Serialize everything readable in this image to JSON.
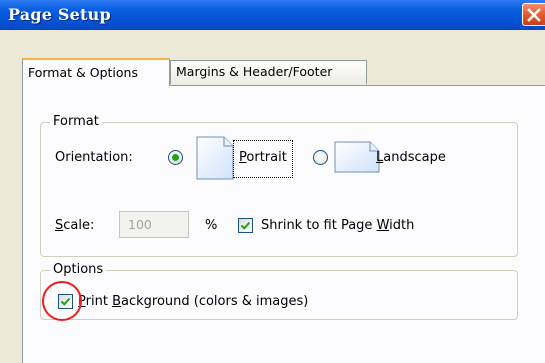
{
  "window": {
    "title": "Page Setup"
  },
  "tabs": [
    {
      "label": "Format & Options",
      "active": true
    },
    {
      "label": "Margins & Header/Footer",
      "active": false
    }
  ],
  "format_group": {
    "legend": "Format",
    "orientation_label": "Orientation:",
    "portrait": {
      "label_mnemonic": "P",
      "label_rest": "ortrait",
      "selected": true
    },
    "landscape": {
      "label_mnemonic": "L",
      "label_rest": "andscape",
      "selected": false
    },
    "scale_label_mnemonic": "S",
    "scale_label_rest": "cale:",
    "scale_value": "100",
    "percent": "%",
    "shrink": {
      "label_before": "Shrink to fit Page ",
      "label_mnemonic": "W",
      "label_after": "idth",
      "checked": true
    }
  },
  "options_group": {
    "legend": "Options",
    "print_background": {
      "label_mnemonic": "P",
      "label_before_mnemonic_extra": "rint ",
      "label_mnemonic2": "B",
      "label_rest": "ackground (colors & images)",
      "checked": true
    }
  },
  "colors": {
    "titlebar": "#0552d6",
    "close": "#e25a2e",
    "tab_highlight": "#f7b24a",
    "radio_dot": "#21a121",
    "check": "#21a121",
    "annotation_circle": "#e8201f"
  },
  "icons": [
    "close-icon",
    "page-icon",
    "check-icon"
  ]
}
